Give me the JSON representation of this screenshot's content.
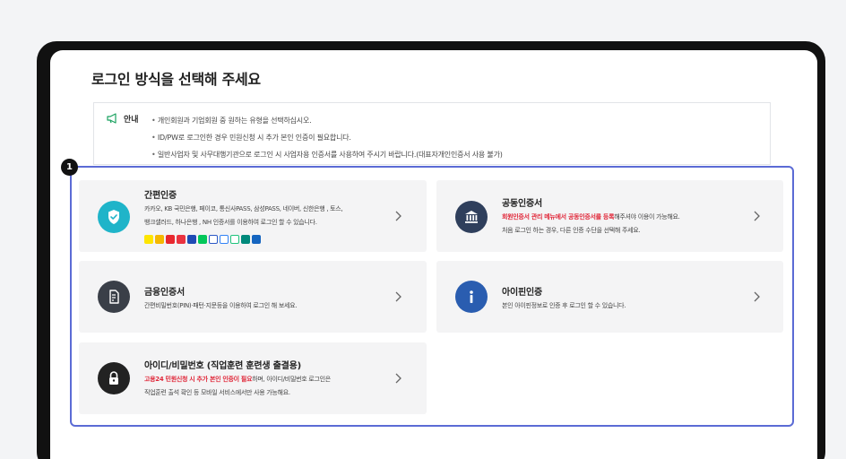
{
  "page": {
    "title": "로그인 방식을 선택해 주세요"
  },
  "notice": {
    "label": "안내",
    "items": [
      "개인회원과 기업회원 중 원하는 유형을 선택하십시오.",
      "ID/PW로 로그인한 경우 민원신청 시 추가 본인 인증이 필요합니다.",
      "일반사업자 및 사무대행기관으로 로그인 시 사업자용 인증서를 사용하여 주시기 바랍니다.(대표자개인인증서 사용 불가)"
    ]
  },
  "badge": "1",
  "cards": {
    "simple": {
      "title": "간편인증",
      "desc1": "카카오, KB 국민은행, 페이코, 통신사PASS, 삼성PASS, 네이버, 신한은행 , 토스,",
      "desc2": "뱅크샐러드, 하나은행 , NH 인증서를 이용하여 로그인 할 수 있습니다."
    },
    "joint": {
      "title": "공동인증서",
      "desc1_red": "회원인증서 관리 메뉴에서 공동인증서를 등록",
      "desc1_rest": "해주셔야 이용이 가능해요.",
      "desc2": "처음 로그인 하는 경우, 다른 인증 수단을 선택해 주세요."
    },
    "finance": {
      "title": "금융인증서",
      "desc1": "간편비밀번호(PIN)·패턴·지문등을 이용하여 로그인 해 보세요."
    },
    "ipin": {
      "title": "아이핀인증",
      "desc1": "본인 아이핀정보로 인증 후 로그인 할 수 있습니다."
    },
    "idpw": {
      "title": "아이디/비밀번호 (직업훈련 훈련생 출결용)",
      "desc1_red": "고용24 민원신청 시 추가 본인 인증이 필요",
      "desc1_rest": "하며, 아이디/비밀번호 로그인은",
      "desc2": "직업훈련 출석 확인 등 모바일 서비스에서만 사용 가능해요."
    }
  },
  "colors": {
    "accent": "#5b6bd5",
    "simple_icon": "#1fb4c9",
    "joint_icon": "#2f3f5c",
    "finance_icon": "#3a3f48",
    "ipin_icon": "#2a5db0",
    "idpw_icon": "#222222",
    "red": "#e0283a"
  },
  "provider_logos": [
    "kakao-logo",
    "kb-logo",
    "payco-logo",
    "pass-logo",
    "samsung-pass-logo",
    "naver-logo",
    "shinhan-logo",
    "toss-logo",
    "banksalad-logo",
    "hana-logo",
    "nh-logo"
  ]
}
